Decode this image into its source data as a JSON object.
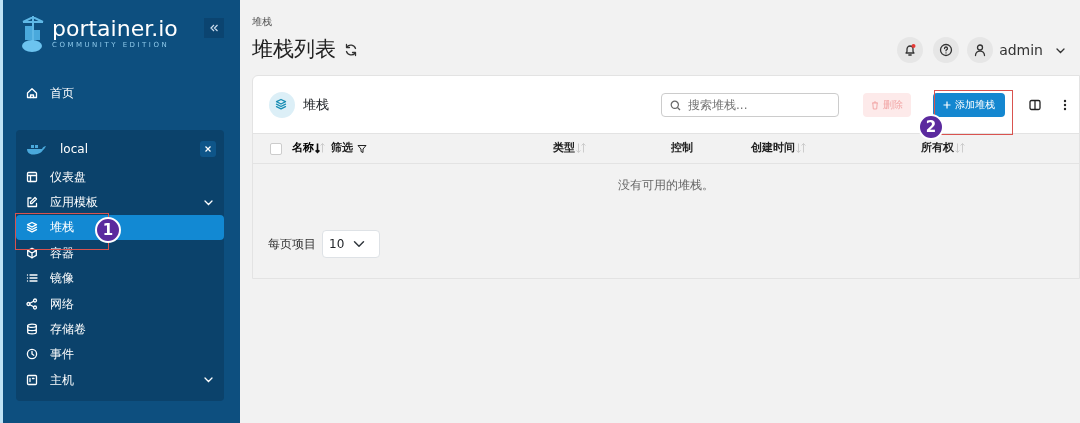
{
  "sidebar": {
    "logo": {
      "name": "portainer.io",
      "edition": "COMMUNITY EDITION"
    },
    "home": "首页",
    "environment": {
      "name": "local",
      "items": [
        {
          "label": "仪表盘",
          "expandable": false,
          "selected": false
        },
        {
          "label": "应用模板",
          "expandable": true,
          "selected": false
        },
        {
          "label": "堆栈",
          "expandable": false,
          "selected": true
        },
        {
          "label": "容器",
          "expandable": false,
          "selected": false
        },
        {
          "label": "镜像",
          "expandable": false,
          "selected": false
        },
        {
          "label": "网络",
          "expandable": false,
          "selected": false
        },
        {
          "label": "存储卷",
          "expandable": false,
          "selected": false
        },
        {
          "label": "事件",
          "expandable": false,
          "selected": false
        },
        {
          "label": "主机",
          "expandable": true,
          "selected": false
        }
      ]
    }
  },
  "header": {
    "breadcrumb": "堆栈",
    "title": "堆栈列表",
    "notification_unread": true,
    "user": "admin"
  },
  "card": {
    "title": "堆栈",
    "search": {
      "placeholder": "搜索堆栈..."
    },
    "delete_button": {
      "label": "删除",
      "disabled": true
    },
    "add_button": {
      "label": "添加堆栈"
    },
    "table": {
      "select_all_checked": false,
      "columns": [
        {
          "label": "名称",
          "sortable": true,
          "sorted": true,
          "filter": "筛选"
        },
        {
          "label": "类型",
          "sortable": true,
          "sorted": false
        },
        {
          "label": "控制",
          "sortable": false,
          "sorted": false
        },
        {
          "label": "创建时间",
          "sortable": true,
          "sorted": false
        },
        {
          "label": "所有权",
          "sortable": true,
          "sorted": false
        }
      ],
      "empty_message": "没有可用的堆栈。"
    },
    "footer": {
      "label": "每页项目",
      "page_size": "10"
    }
  },
  "annotations": [
    {
      "label": "1"
    },
    {
      "label": "2"
    }
  ]
}
